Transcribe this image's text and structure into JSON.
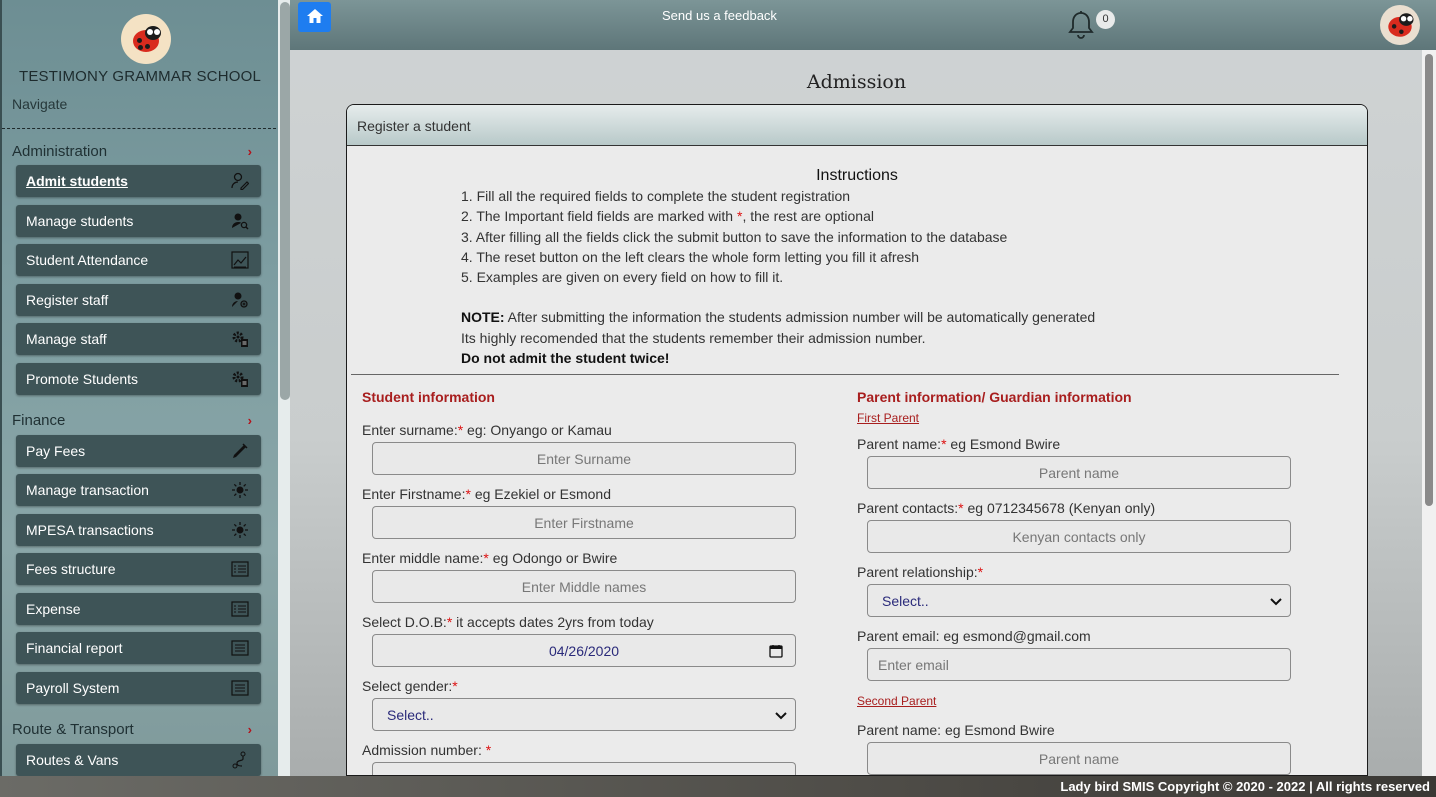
{
  "sidebar": {
    "school_name": "TESTIMONY GRAMMAR SCHOOL",
    "navigate": "Navigate",
    "sections": {
      "administration": "Administration",
      "finance": "Finance",
      "transport": "Route & Transport"
    },
    "admin_items": [
      {
        "label": "Admit students",
        "icon": "user-edit-icon"
      },
      {
        "label": "Manage students",
        "icon": "user-search-icon"
      },
      {
        "label": "Student Attendance",
        "icon": "attendance-chart-icon"
      },
      {
        "label": "Register staff",
        "icon": "user-add-icon"
      },
      {
        "label": "Manage staff",
        "icon": "gear-doc-icon"
      },
      {
        "label": "Promote Students",
        "icon": "gear-doc-icon"
      }
    ],
    "finance_items": [
      {
        "label": "Pay Fees",
        "icon": "pen-icon"
      },
      {
        "label": "Manage transaction",
        "icon": "sun-icon"
      },
      {
        "label": "MPESA transactions",
        "icon": "sun-icon"
      },
      {
        "label": "Fees structure",
        "icon": "list-icon"
      },
      {
        "label": "Expense",
        "icon": "list-icon"
      },
      {
        "label": "Financial report",
        "icon": "report-icon"
      },
      {
        "label": "Payroll System",
        "icon": "report-icon"
      }
    ],
    "transport_items": [
      {
        "label": "Routes & Vans",
        "icon": "route-icon"
      }
    ]
  },
  "topbar": {
    "feedback": "Send us a feedback",
    "notification_count": "0"
  },
  "page": {
    "title": "Admission",
    "card_title": "Register a student",
    "instructions_title": "Instructions",
    "instructions": [
      "1. Fill all the required fields to complete the student registration",
      "2. The Important field fields are marked with ",
      "3. After filling all the fields click the submit button to save the information to the database",
      "4. The reset button on the left clears the whole form letting you fill it afresh",
      "5. Examples are given on every field on how to fill it."
    ],
    "instr2_star": "*",
    "instr2_tail": ", the rest are optional",
    "note_label": "NOTE:",
    "note_text": " After submitting the information the students admission number will be automatically generated",
    "note_line2": "Its highly recomended that the students remember their admission number.",
    "note_line3": "Do not admit the student twice!"
  },
  "student": {
    "title": "Student information",
    "surname_label": "Enter surname:",
    "surname_hint": " eg: Onyango or Kamau",
    "surname_placeholder": "Enter Surname",
    "firstname_label": "Enter Firstname:",
    "firstname_hint": " eg Ezekiel or Esmond",
    "firstname_placeholder": "Enter Firstname",
    "middle_label": "Enter middle name:",
    "middle_hint": " eg Odongo or Bwire",
    "middle_placeholder": "Enter Middle names",
    "dob_label": "Select D.O.B:",
    "dob_hint": " it accepts dates 2yrs from today",
    "dob_value": "04/26/2020",
    "gender_label": "Select gender:",
    "gender_value": "Select..",
    "admno_label": "Admission number: ",
    "star": "*"
  },
  "parent": {
    "title": "Parent information/ Guardian information",
    "first_parent": "First Parent",
    "name_label": "Parent name:",
    "name_hint": " eg Esmond Bwire",
    "name_placeholder": "Parent name",
    "contacts_label": "Parent contacts:",
    "contacts_hint": " eg 0712345678 (Kenyan only)",
    "contacts_placeholder": "Kenyan contacts only",
    "relationship_label": "Parent relationship:",
    "relationship_value": "Select..",
    "email_label": "Parent email: eg esmond@gmail.com",
    "email_placeholder": "Enter email",
    "second_parent": "Second Parent",
    "name2_label": "Parent name: eg Esmond Bwire",
    "name2_placeholder": "Parent name",
    "star": "*"
  },
  "footer": {
    "text": "Lady bird SMIS Copyright © 2020 - 2022 | All rights reserved"
  },
  "colors": {
    "accent": "#1e7df0",
    "required": "#dd1111",
    "section_title": "#a81e1e",
    "nav_button": "#3e5457"
  }
}
